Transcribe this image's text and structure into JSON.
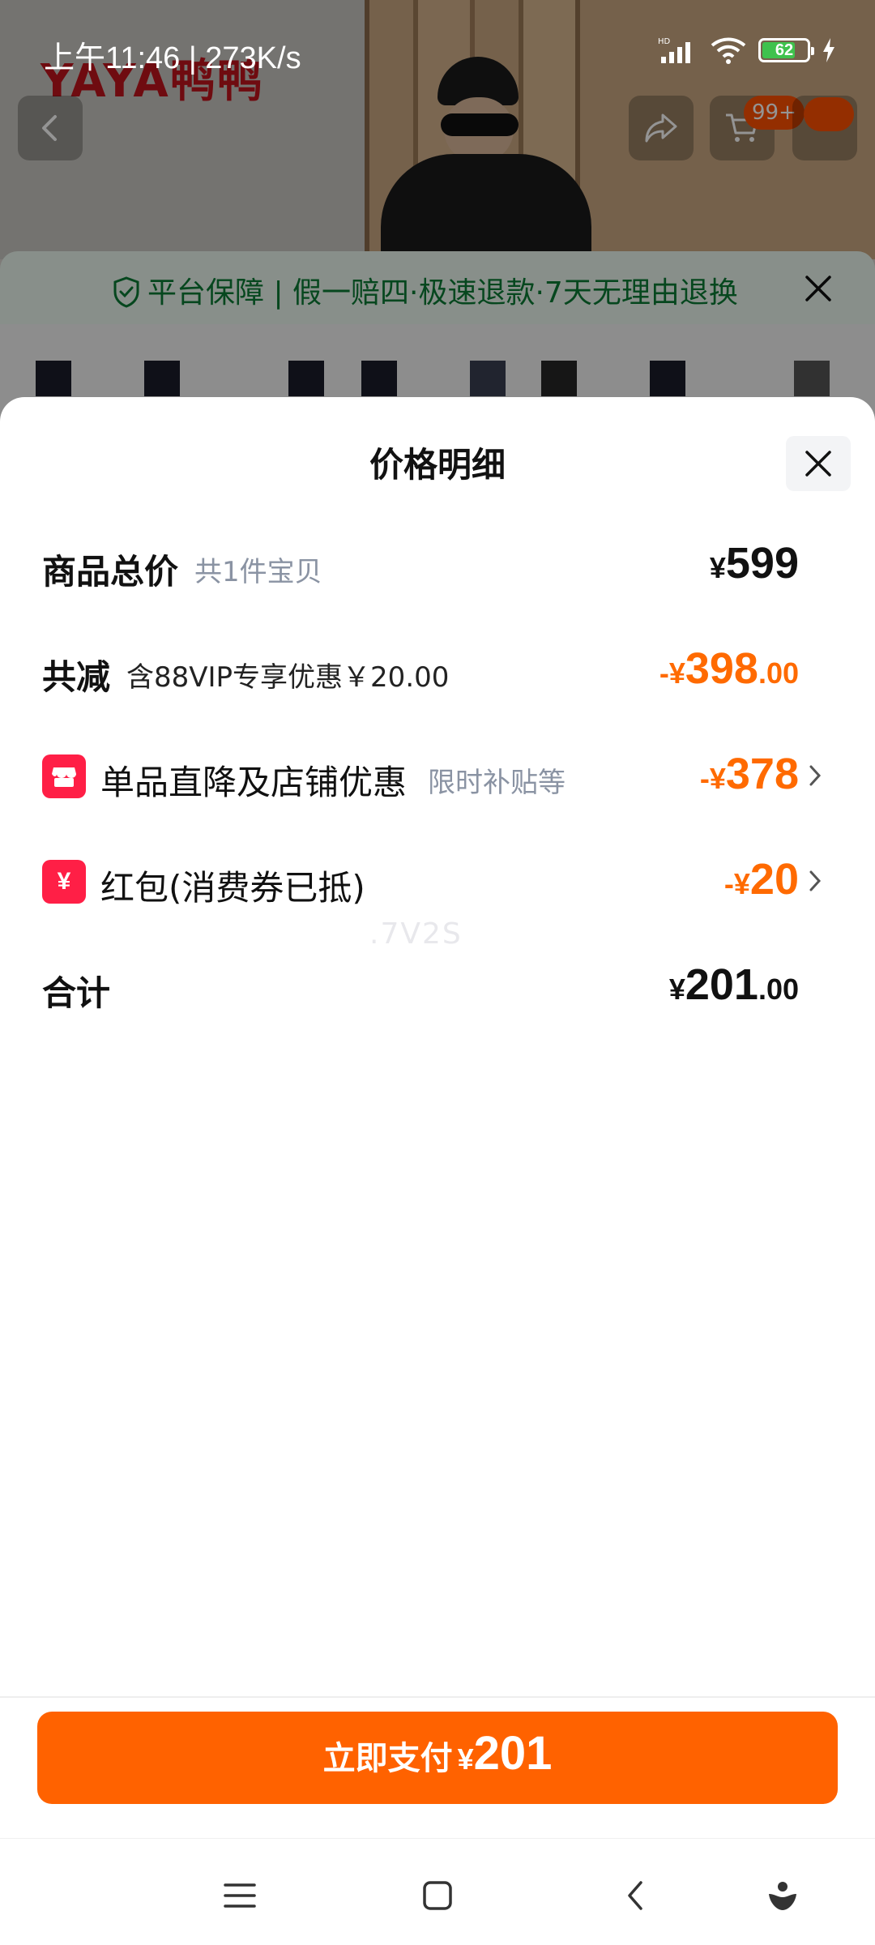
{
  "status_bar": {
    "time": "上午11:46 | 273K/s",
    "battery": "62"
  },
  "background_page": {
    "brand_logo_text": "YAYA鸭鸭",
    "cart_badge": "99+",
    "guarantee": {
      "title": "平台保障",
      "details": "| 假一赔四·极速退款·7天无理由退换"
    }
  },
  "sheet": {
    "title": "价格明细",
    "rows": {
      "total": {
        "label": "商品总价",
        "sub": "共1件宝贝",
        "currency": "¥",
        "int": "599",
        "dec": ""
      },
      "reduction": {
        "label": "共减",
        "sub": "含88VIP专享优惠￥20.00",
        "currency": "-¥",
        "int": "398",
        "dec": ".00"
      },
      "single_item": {
        "label": "单品直降及店铺优惠",
        "sub": "限时补贴等",
        "currency": "-¥",
        "int": "378",
        "dec": ""
      },
      "red_packet": {
        "label": "红包(消费券已抵)",
        "icon_glyph": "¥",
        "currency": "-¥",
        "int": "20",
        "dec": ""
      },
      "sum": {
        "label": "合计",
        "currency": "¥",
        "int": "201",
        "dec": ".00"
      }
    },
    "watermark": ".7V2S"
  },
  "pay_button": {
    "label": "立即支付",
    "currency": "¥",
    "amount": "201"
  },
  "colors": {
    "accent_orange": "#ff6200",
    "discount_orange": "#ff6a00",
    "icon_red": "#ff1f46",
    "guarantee_green": "#0b7a35"
  },
  "icons": [
    "back-icon",
    "share-icon",
    "cart-icon",
    "shield-check-icon",
    "close-icon",
    "shop-icon",
    "coupon-icon",
    "chevron-right-icon",
    "menu-icon",
    "home-icon",
    "back-nav-icon",
    "assistant-icon"
  ]
}
